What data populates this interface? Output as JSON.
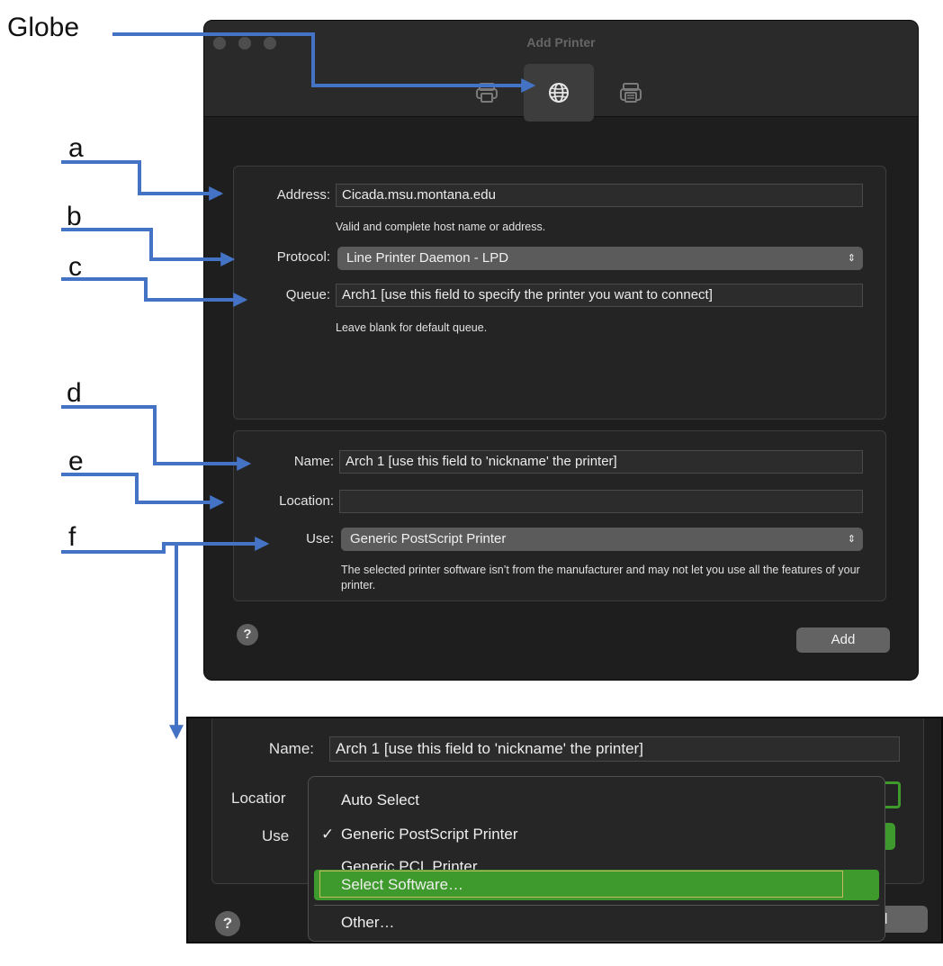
{
  "callouts": {
    "globe": "Globe",
    "a": "a",
    "b": "b",
    "c": "c",
    "d": "d",
    "e": "e",
    "f": "f"
  },
  "window": {
    "title": "Add Printer",
    "toolbar": [
      {
        "name": "default-printer-icon",
        "selected": false
      },
      {
        "name": "globe-icon",
        "selected": true
      },
      {
        "name": "windows-printer-icon",
        "selected": false
      }
    ]
  },
  "connection": {
    "address_label": "Address:",
    "address_value": "Cicada.msu.montana.edu",
    "address_hint": "Valid and complete host name or address.",
    "protocol_label": "Protocol:",
    "protocol_value": "Line Printer Daemon - LPD",
    "queue_label": "Queue:",
    "queue_value": "Arch1 [use this field to specify the printer you want to connect]",
    "queue_hint": "Leave blank for default queue."
  },
  "printer": {
    "name_label": "Name:",
    "name_value": "Arch 1 [use this field to 'nickname' the printer]",
    "location_label": "Location:",
    "location_value": "",
    "use_label": "Use:",
    "use_value": "Generic PostScript Printer",
    "use_hint": "The selected printer software isn’t from the manufacturer and may not let you use all the features of your printer."
  },
  "footer": {
    "help_label": "?",
    "add_label": "Add"
  },
  "inset": {
    "name_label": "Name:",
    "name_value": "Arch 1 [use this field to 'nickname' the printer]",
    "location_label_partial": "Locatior",
    "use_label_partial": "Use",
    "help_label": "?",
    "add_label_partial": "d",
    "menu": {
      "checkmark": "✓",
      "items": [
        "Auto Select",
        "Generic PostScript Printer",
        "Generic PCL Printer",
        "Select Software…",
        "Other…"
      ],
      "checked_index": 1,
      "highlighted_index": 3
    }
  },
  "colors": {
    "arrow": "#4472c4",
    "window_bg": "#1e1e1e",
    "menu_highlight": "#3e9a2c",
    "focus_ring": "#3e9a2c"
  }
}
